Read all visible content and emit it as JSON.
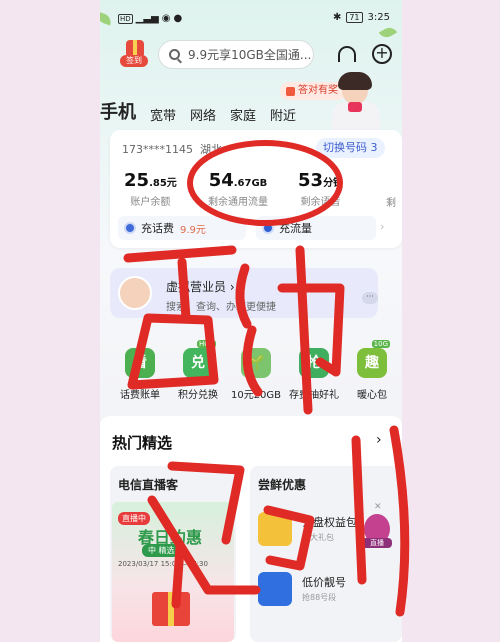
{
  "status_bar": {
    "network": "HD",
    "signal": "᪤",
    "wifi_speed": "((·))",
    "battery": "71",
    "time": "3:25"
  },
  "top": {
    "signin_label": "签到",
    "search_placeholder": "9.9元享10GB全国通...",
    "promo_badge": "答对有奖"
  },
  "nav": {
    "tabs": [
      "手机",
      "宽带",
      "网络",
      "家庭",
      "附近"
    ]
  },
  "account_card": {
    "phone": "173****1145",
    "region": "湖北",
    "switch_label": "切换号码 3",
    "stats": [
      {
        "value": "25",
        "decimal": ".85",
        "unit": "元",
        "label": "账户余额"
      },
      {
        "value": "54",
        "decimal": ".67",
        "unit": "GB",
        "label": "剩余通用流量"
      },
      {
        "value": "53",
        "decimal": "",
        "unit": "分钟",
        "label": "剩余语音"
      }
    ],
    "extra_stat_label": "剩",
    "actions": [
      {
        "label": "充话费",
        "sub": "9.9元"
      },
      {
        "label": "充流量",
        "sub": ""
      }
    ]
  },
  "virtual_banner": {
    "title": "虚拟营业员",
    "desc": "搜索、查询、办理更便捷"
  },
  "quick_items": [
    {
      "label": "话费账单",
      "glyph": "看",
      "color": "#4caf50"
    },
    {
      "label": "积分兑换",
      "glyph": "兑",
      "color": "#43b55c",
      "tag": "HOT"
    },
    {
      "label": "10元20GB",
      "glyph": "🌱",
      "color": "#7cc46e"
    },
    {
      "label": "存费抽好礼",
      "glyph": "抢",
      "color": "#3fae5f"
    },
    {
      "label": "暖心包",
      "glyph": "趣",
      "color": "#7dbe3b",
      "tag": "10G"
    }
  ],
  "hot_section": {
    "title": "热门精选",
    "card_left_title": "电信直播客",
    "card_right_title": "尝鲜优惠",
    "live_tag": "直播中",
    "live_title": "春日约惠",
    "live_sub": "中 精选",
    "live_date": "2023/03/17 15:00—17:30",
    "products": [
      {
        "name": "云盘权益包",
        "sub": "享大礼包"
      },
      {
        "name": "低价靓号",
        "sub": "抢88号段"
      }
    ],
    "float_label": "直播"
  },
  "colors": {
    "accent_red": "#e02a26",
    "brand_blue": "#3d5fcc"
  }
}
